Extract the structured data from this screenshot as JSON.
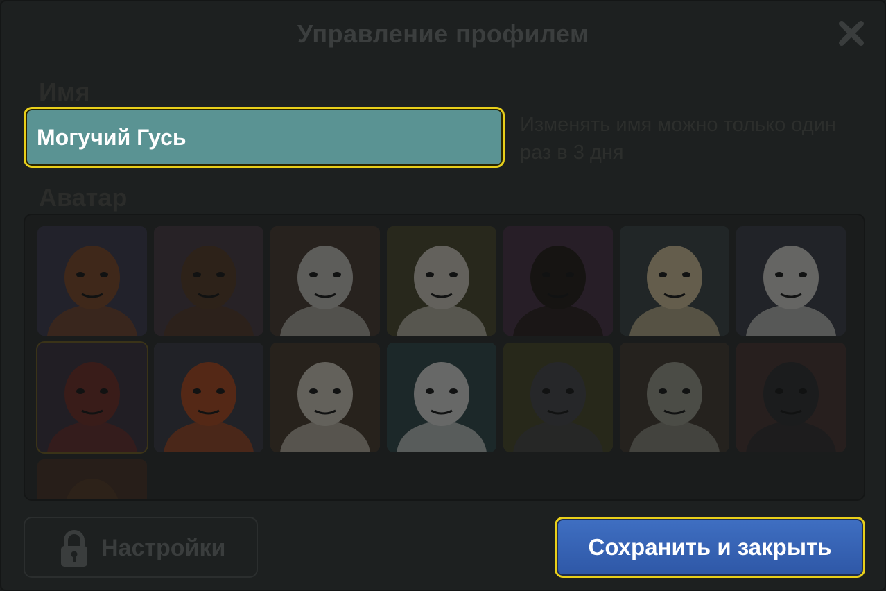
{
  "dialog": {
    "title": "Управление профилем"
  },
  "name_section": {
    "label": "Имя",
    "value": "Могучий Гусь",
    "hint": "Изменять имя можно только один раз в 3 дня"
  },
  "avatar_section": {
    "label": "Аватар",
    "avatars": [
      {
        "id": "fox",
        "bg": "#3d3a52",
        "main": "#8a4a25"
      },
      {
        "id": "bear",
        "bg": "#4a3a44",
        "main": "#5b3a22"
      },
      {
        "id": "astronaut",
        "bg": "#4a3a30",
        "main": "#d8d4cc"
      },
      {
        "id": "goat",
        "bg": "#4e4a2a",
        "main": "#e6e0d2"
      },
      {
        "id": "queen",
        "bg": "#4a3048",
        "main": "#1f1612"
      },
      {
        "id": "princess",
        "bg": "#3a4648",
        "main": "#e9d4a8"
      },
      {
        "id": "old-king",
        "bg": "#3a3e4a",
        "main": "#eceae4"
      },
      {
        "id": "officer",
        "bg": "#3a3040",
        "main": "#7a2a24"
      },
      {
        "id": "rooster",
        "bg": "#3a3c48",
        "main": "#c04a1c"
      },
      {
        "id": "skeleton",
        "bg": "#4a3a2c",
        "main": "#e6e0d0"
      },
      {
        "id": "snowman",
        "bg": "#2e4a4c",
        "main": "#f2f2f0"
      },
      {
        "id": "wolf",
        "bg": "#4a4a26",
        "main": "#48484e"
      },
      {
        "id": "vampire",
        "bg": "#463a30",
        "main": "#a8a898"
      },
      {
        "id": "witch",
        "bg": "#4a3430",
        "main": "#2a2a2e"
      },
      {
        "id": "deer",
        "bg": "#4a3022",
        "main": "#5a3a22"
      }
    ],
    "selected_index": 7
  },
  "buttons": {
    "settings_label": "Настройки",
    "save_label": "Сохранить и закрыть"
  },
  "colors": {
    "accent_border": "#e8cf1a",
    "input_bg": "#5a9393",
    "save_bg": "#3f6fc2"
  }
}
